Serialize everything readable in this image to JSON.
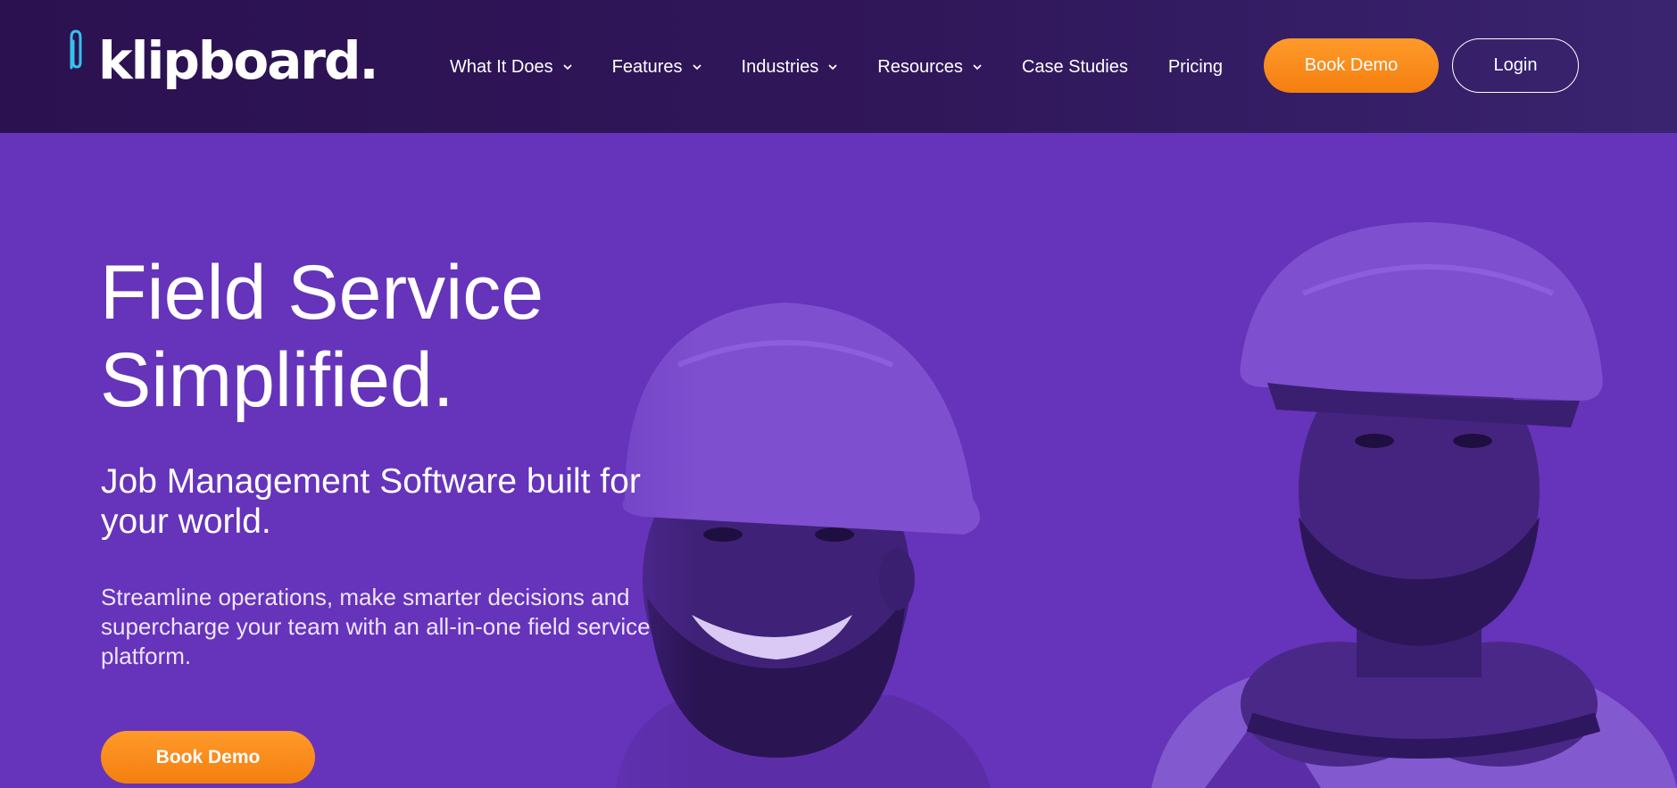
{
  "brand": {
    "name": "klipboard",
    "dot": ".",
    "accent_color": "#ff8c1a",
    "logo_clip_color": "#35c2ee"
  },
  "nav": {
    "items": [
      {
        "label": "What It Does",
        "has_dropdown": true
      },
      {
        "label": "Features",
        "has_dropdown": true
      },
      {
        "label": "Industries",
        "has_dropdown": true
      },
      {
        "label": "Resources",
        "has_dropdown": true
      },
      {
        "label": "Case Studies",
        "has_dropdown": false
      },
      {
        "label": "Pricing",
        "has_dropdown": false
      }
    ],
    "book_demo_label": "Book Demo",
    "login_label": "Login"
  },
  "hero": {
    "title_line1": "Field Service",
    "title_line2": "Simplified.",
    "subtitle": "Job Management Software built for your world.",
    "description": "Streamline operations, make smarter decisions and supercharge your team with an all-in-one field service platform.",
    "cta_label": "Book Demo",
    "background_color": "#6633bb"
  },
  "icons": {
    "logo": "paperclip-icon",
    "dropdown": "chevron-down-icon"
  }
}
